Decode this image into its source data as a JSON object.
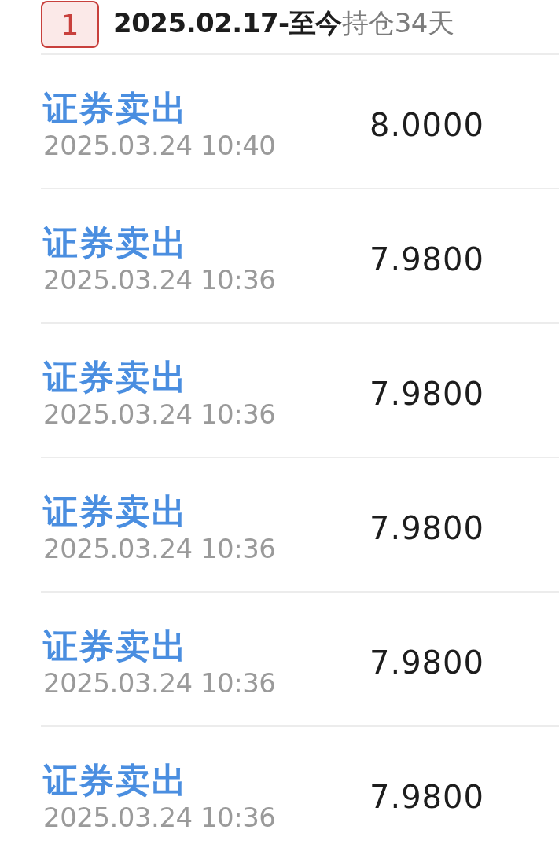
{
  "header": {
    "badge": "1",
    "period": "2025.02.17-至今",
    "holding": "持仓34天"
  },
  "trades": [
    {
      "type": "证券卖出",
      "time": "2025.03.24 10:40",
      "price": "8.0000"
    },
    {
      "type": "证券卖出",
      "time": "2025.03.24 10:36",
      "price": "7.9800"
    },
    {
      "type": "证券卖出",
      "time": "2025.03.24 10:36",
      "price": "7.9800"
    },
    {
      "type": "证券卖出",
      "time": "2025.03.24 10:36",
      "price": "7.9800"
    },
    {
      "type": "证券卖出",
      "time": "2025.03.24 10:36",
      "price": "7.9800"
    },
    {
      "type": "证券卖出",
      "time": "2025.03.24 10:36",
      "price": "7.9800"
    }
  ]
}
